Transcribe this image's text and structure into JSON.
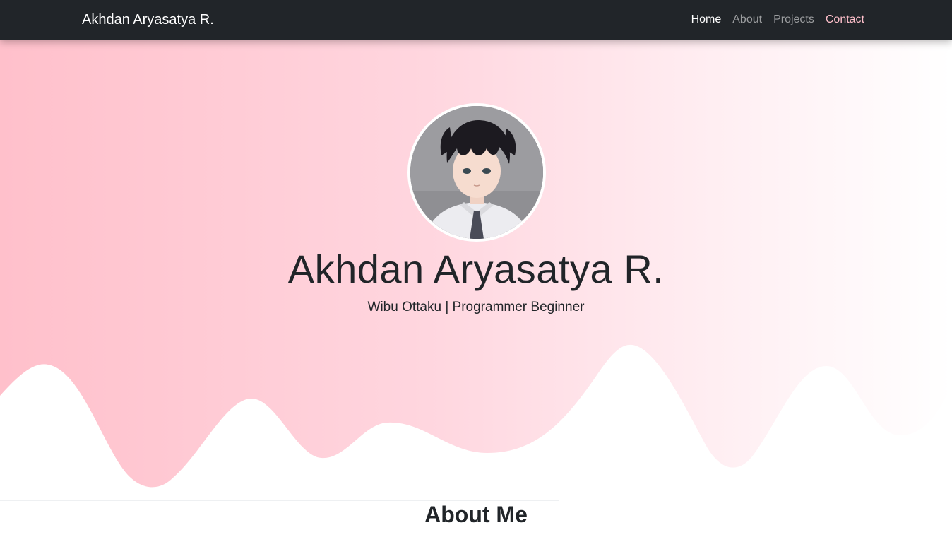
{
  "navbar": {
    "brand": "Akhdan Aryasatya R.",
    "links": [
      {
        "label": "Home",
        "state": "active"
      },
      {
        "label": "About",
        "state": "inactive"
      },
      {
        "label": "Projects",
        "state": "inactive"
      },
      {
        "label": "Contact",
        "state": "highlighted"
      }
    ]
  },
  "hero": {
    "avatar_icon": "profile-photo-anime-boy",
    "title": "Akhdan Aryasatya R.",
    "subtitle": "Wibu Ottaku | Programmer Beginner",
    "gradient_colors": [
      "#ffc0cb",
      "#ffffff"
    ]
  },
  "about": {
    "heading": "About Me"
  },
  "colors": {
    "navbar_bg": "#212529",
    "accent_pink": "#ffc0cb",
    "text_dark": "#212529"
  }
}
